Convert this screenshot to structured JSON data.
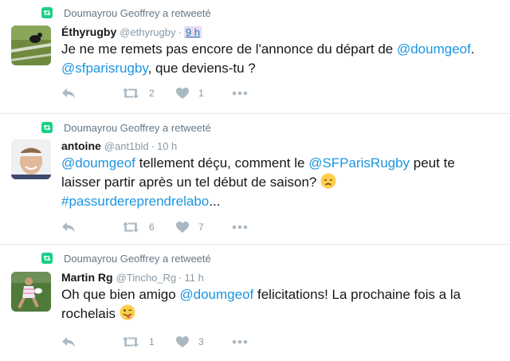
{
  "colors": {
    "retweet_green": "#19cf86",
    "link_blue": "#1b95e0",
    "icon_gray": "#aab8c2",
    "text_gray": "#657786"
  },
  "tweets": [
    {
      "context": "Doumayrou Geoffrey a retweeté",
      "fullname": "Éthyrugby",
      "handle": "@ethyrugby",
      "separator": "·",
      "time": "9 h",
      "line1_a": "Je ne me remets pas encore de l'annonce du départ de ",
      "line1_mention": "@doumgeof",
      "line1_b": ".",
      "line2_mention": "@sfparisrugby",
      "line2_b": ", que deviens-tu ?",
      "retweets": "2",
      "likes": "1"
    },
    {
      "context": "Doumayrou Geoffrey a retweeté",
      "fullname": "antoine",
      "handle": "@ant1bld",
      "separator": "·",
      "time": "10 h",
      "line1_mention": "@doumgeof",
      "line1_b": " tellement déçu, comment le ",
      "line1_mention2": "@SFParisRugby",
      "line1_c": " peut te",
      "line2_a": "laisser partir après un tel début de saison? ",
      "line3_mention": "#passurdereprendrelabo",
      "line3_b": "...",
      "emoji": "disappointed-face",
      "retweets": "6",
      "likes": "7"
    },
    {
      "context": "Doumayrou Geoffrey a retweeté",
      "fullname": "Martin Rg",
      "handle": "@Tincho_Rg",
      "separator": "·",
      "time": "11 h",
      "line1_a": "Oh que bien amigo ",
      "line1_mention": "@doumgeof",
      "line1_b": " felicitations! La prochaine fois a la",
      "line2_a": "rochelais ",
      "emoji": "winking-tongue-face",
      "retweets": "1",
      "likes": "3"
    }
  ]
}
